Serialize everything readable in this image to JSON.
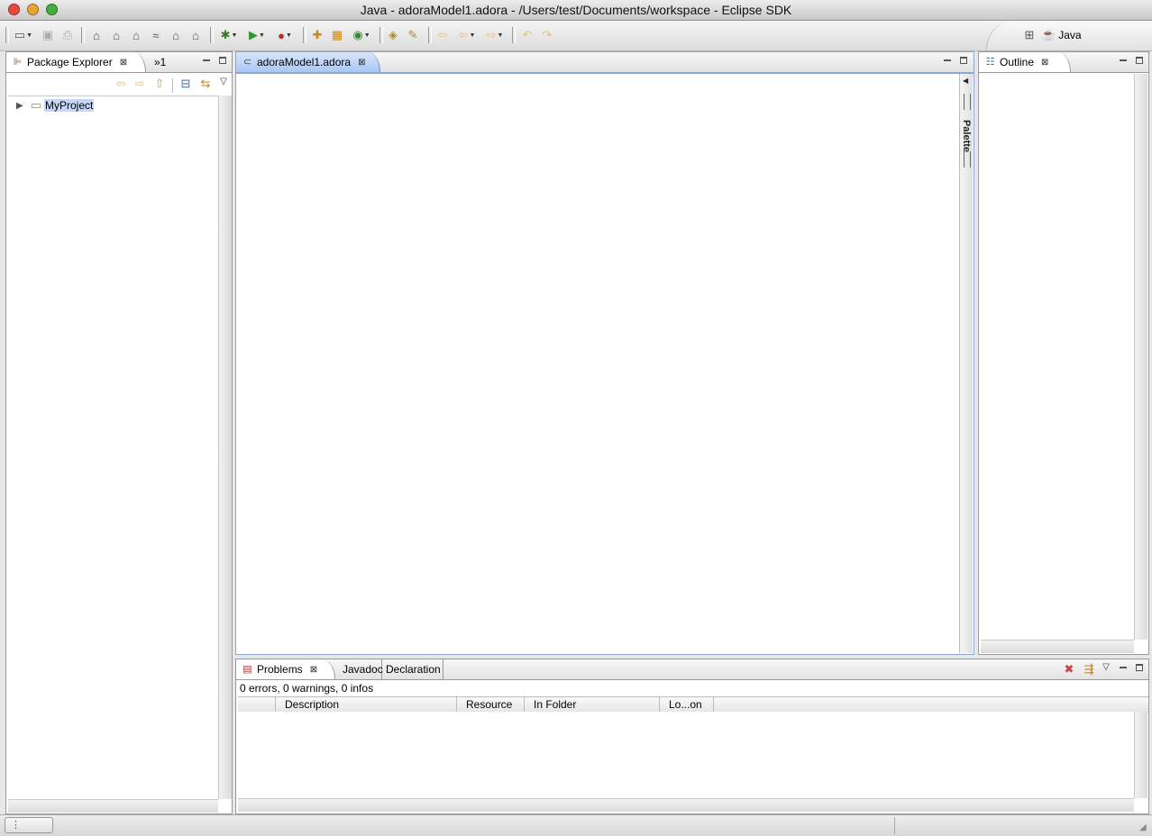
{
  "window": {
    "title": "Java - adoraModel1.adora - /Users/test/Documents/workspace - Eclipse SDK",
    "traffic_lights": {
      "close": "#ff5f57",
      "minimize": "#febc2e",
      "zoom": "#28c840"
    }
  },
  "toolbar": {
    "perspective_label": "Java"
  },
  "package_explorer": {
    "tab_label": "Package Explorer",
    "overflow_label": "»1",
    "tree": [
      {
        "label": "MyProject",
        "selected": true
      }
    ]
  },
  "editor": {
    "tab_label": "adoraModel1.adora",
    "palette_label": "Palette"
  },
  "outline": {
    "tab_label": "Outline"
  },
  "bottom_panel": {
    "tabs": [
      "Problems",
      "Javadoc",
      "Declaration"
    ],
    "summary": "0 errors, 0 warnings, 0 infos",
    "columns": [
      "Description",
      "Resource",
      "In Folder",
      "Lo...on"
    ]
  },
  "colors": {
    "selection": "#c5d8f7",
    "editor_tab_active": "#a9c6f4"
  }
}
